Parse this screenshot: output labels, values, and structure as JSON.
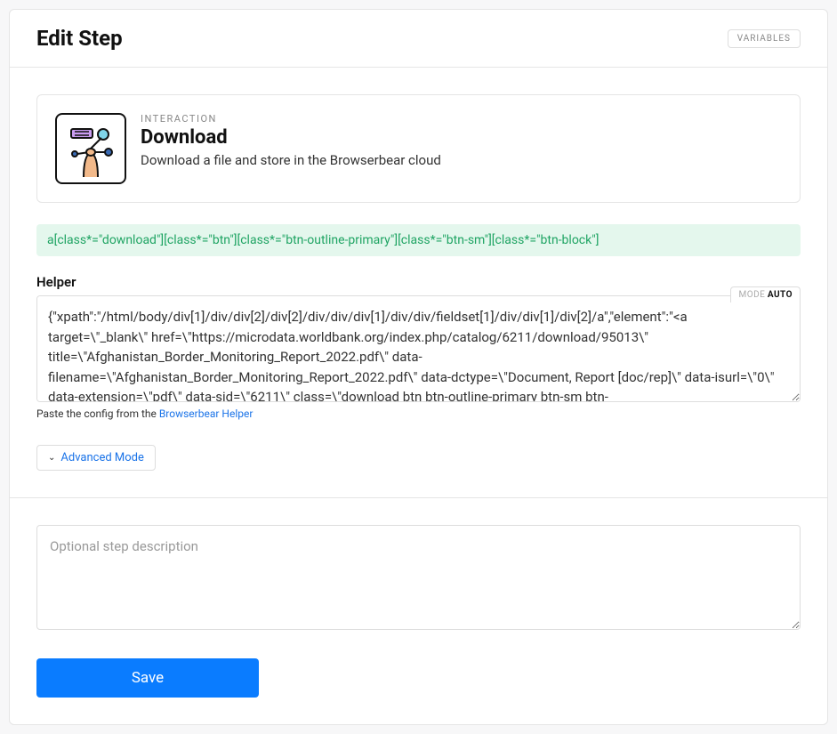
{
  "header": {
    "title": "Edit Step",
    "variables_btn": "VARIABLES"
  },
  "interaction": {
    "label": "INTERACTION",
    "title": "Download",
    "description": "Download a file and store in the Browserbear cloud"
  },
  "selector": "a[class*=\"download\"][class*=\"btn\"][class*=\"btn-outline-primary\"][class*=\"btn-sm\"][class*=\"btn-block\"]",
  "helper": {
    "label": "Helper",
    "mode_label": "MODE",
    "mode_value": "AUTO",
    "textarea_value": "{\"xpath\":\"/html/body/div[1]/div/div[2]/div[2]/div/div/div[1]/div/div/fieldset[1]/div/div[1]/div[2]/a\",\"element\":\"<a target=\\\"_blank\\\" href=\\\"https://microdata.worldbank.org/index.php/catalog/6211/download/95013\\\" title=\\\"Afghanistan_Border_Monitoring_Report_2022.pdf\\\" data-filename=\\\"Afghanistan_Border_Monitoring_Report_2022.pdf\\\" data-dctype=\\\"Document, Report [doc/rep]\\\" data-isurl=\\\"0\\\" data-extension=\\\"pdf\\\" data-sid=\\\"6211\\\" class=\\\"download btn btn-outline-primary btn-sm btn-",
    "hint_prefix": "Paste the config from the ",
    "hint_link": "Browserbear Helper"
  },
  "advanced_mode": "Advanced Mode",
  "description_placeholder": "Optional step description",
  "save_btn": "Save"
}
